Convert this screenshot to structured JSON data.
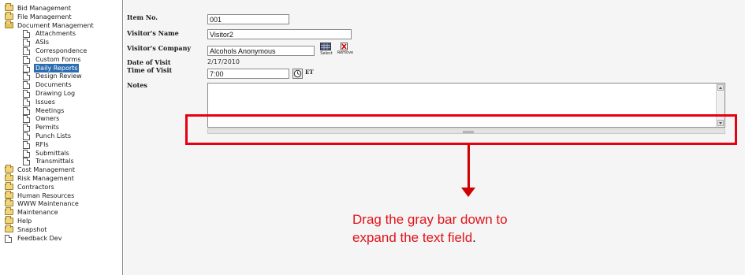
{
  "sidebar": {
    "items": [
      {
        "label": "Bid Management",
        "icon": "folder-icon"
      },
      {
        "label": "File Management",
        "icon": "folder-icon"
      },
      {
        "label": "Document Management",
        "icon": "folder-open-icon"
      },
      {
        "label": "Attachments",
        "icon": "document-icon"
      },
      {
        "label": "ASIs",
        "icon": "document-icon"
      },
      {
        "label": "Correspondence",
        "icon": "document-icon"
      },
      {
        "label": "Custom Forms",
        "icon": "document-icon"
      },
      {
        "label": "Daily Reports",
        "icon": "document-icon",
        "selected": true
      },
      {
        "label": "Design Review",
        "icon": "document-icon"
      },
      {
        "label": "Documents",
        "icon": "document-icon"
      },
      {
        "label": "Drawing Log",
        "icon": "document-icon"
      },
      {
        "label": "Issues",
        "icon": "document-icon"
      },
      {
        "label": "Meetings",
        "icon": "document-icon"
      },
      {
        "label": "Owners",
        "icon": "document-icon"
      },
      {
        "label": "Permits",
        "icon": "document-icon"
      },
      {
        "label": "Punch Lists",
        "icon": "document-icon"
      },
      {
        "label": "RFIs",
        "icon": "document-icon"
      },
      {
        "label": "Submittals",
        "icon": "document-icon"
      },
      {
        "label": "Transmittals",
        "icon": "document-icon"
      },
      {
        "label": "Cost Management",
        "icon": "folder-icon"
      },
      {
        "label": "Risk Management",
        "icon": "folder-icon"
      },
      {
        "label": "Contractors",
        "icon": "folder-icon"
      },
      {
        "label": "Human Resources",
        "icon": "folder-icon"
      },
      {
        "label": "WWW Maintenance",
        "icon": "folder-icon"
      },
      {
        "label": "Maintenance",
        "icon": "folder-icon"
      },
      {
        "label": "Help",
        "icon": "folder-icon"
      },
      {
        "label": "Snapshot",
        "icon": "folder-icon"
      },
      {
        "label": "Feedback Dev",
        "icon": "document-icon"
      }
    ]
  },
  "form": {
    "item_no": {
      "label": "Item No.",
      "value": "001"
    },
    "visitor_name": {
      "label": "Visitor's Name",
      "value": "Visitor2"
    },
    "visitor_company": {
      "label": "Visitor's Company",
      "value": "Alcohols Anonymous",
      "select_label": "Select",
      "remove_label": "Remove"
    },
    "date_of_visit": {
      "label": "Date of Visit",
      "value": "2/17/2010"
    },
    "time_of_visit": {
      "label": "Time of Visit",
      "value": "7:00",
      "timezone": "ET"
    },
    "notes": {
      "label": "Notes",
      "value": ""
    }
  },
  "annotation": {
    "line1": "Drag the gray bar down to",
    "line2": "expand the text field",
    "period": "."
  },
  "colors": {
    "highlight": "#e8000f",
    "annotation_text": "#e0141b",
    "selected_item": "#2a6db0"
  }
}
